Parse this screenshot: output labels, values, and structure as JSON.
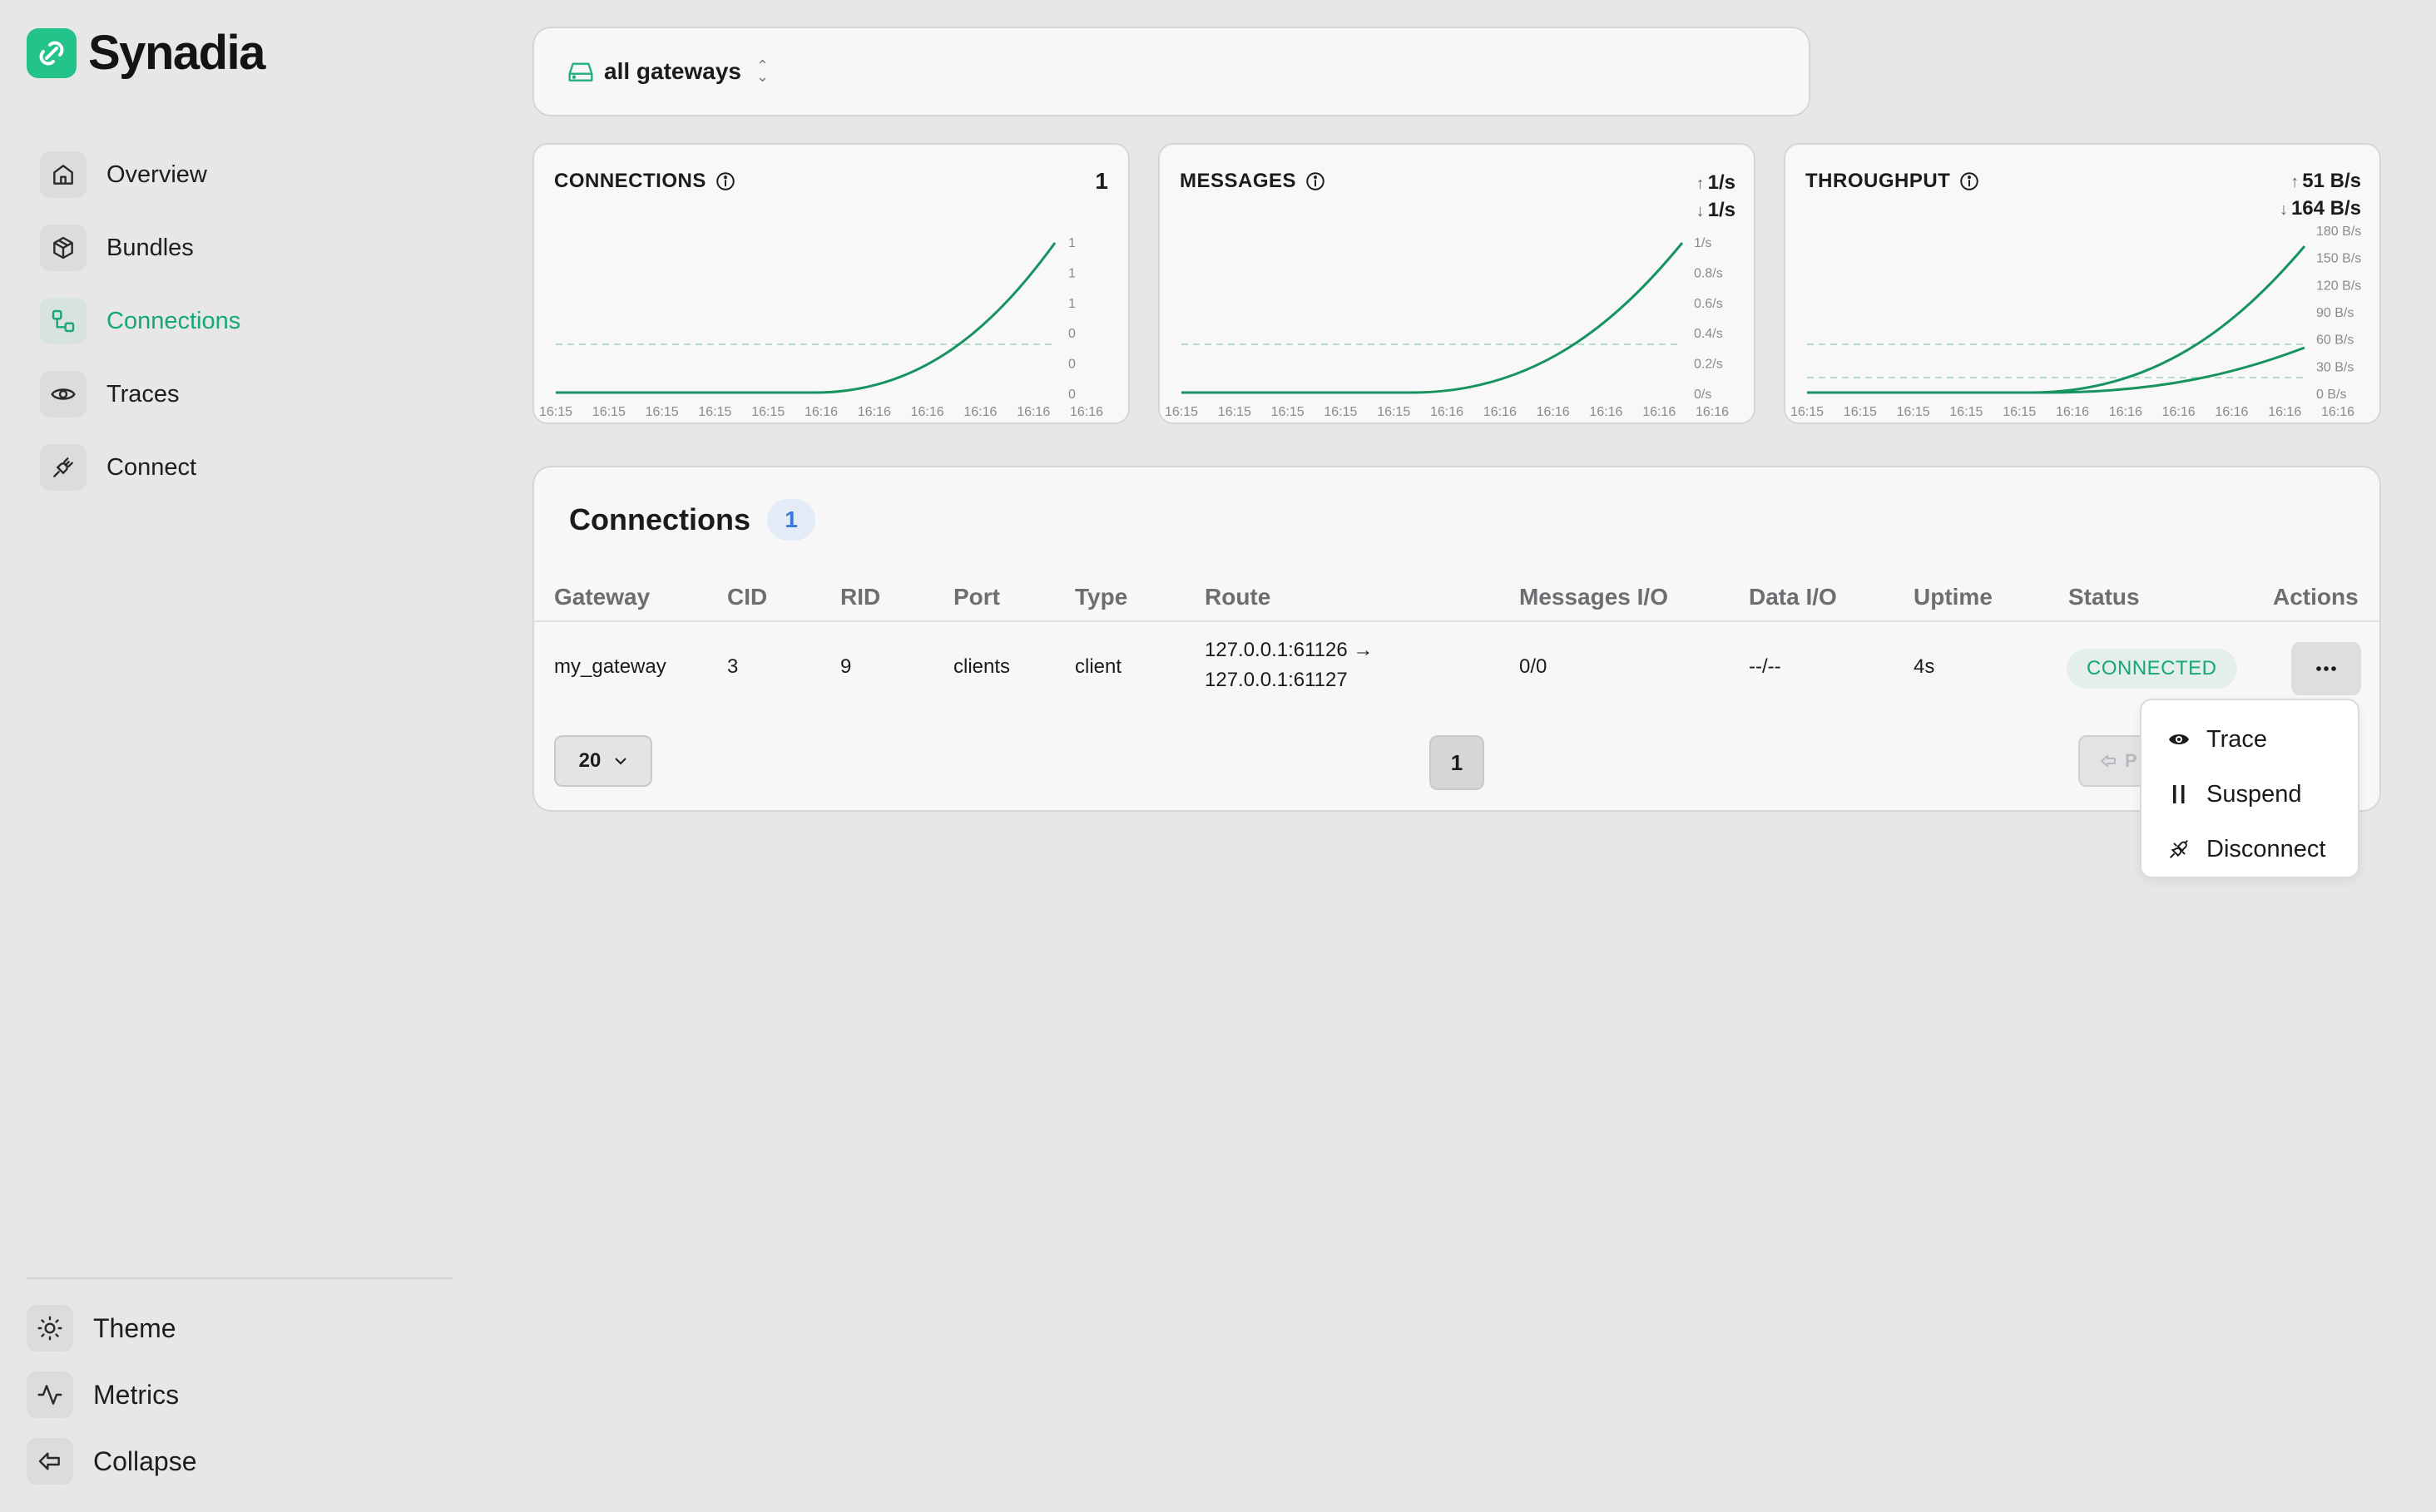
{
  "brand": {
    "name": "Synadia",
    "color": "#23c38a"
  },
  "sidebar": {
    "items": [
      {
        "label": "Overview",
        "icon": "home-icon",
        "active": false
      },
      {
        "label": "Bundles",
        "icon": "box-icon",
        "active": false
      },
      {
        "label": "Connections",
        "icon": "connections-icon",
        "active": true
      },
      {
        "label": "Traces",
        "icon": "eye-icon",
        "active": false
      },
      {
        "label": "Connect",
        "icon": "plug-icon",
        "active": false
      }
    ],
    "bottom": [
      {
        "label": "Theme",
        "icon": "sun-icon"
      },
      {
        "label": "Metrics",
        "icon": "activity-icon"
      },
      {
        "label": "Collapse",
        "icon": "collapse-arrow-icon"
      }
    ]
  },
  "gateway_selector": {
    "value": "all gateways"
  },
  "metrics": {
    "connections": {
      "title": "CONNECTIONS",
      "value": "1",
      "y_ticks": [
        "1",
        "1",
        "1",
        "0",
        "0",
        "0"
      ],
      "x_ticks": [
        "16:15",
        "16:15",
        "16:15",
        "16:15",
        "16:15",
        "16:16",
        "16:16",
        "16:16",
        "16:16",
        "16:16",
        "16:16"
      ]
    },
    "messages": {
      "title": "MESSAGES",
      "up": "1/s",
      "down": "1/s",
      "y_ticks": [
        "1/s",
        "0.8/s",
        "0.6/s",
        "0.4/s",
        "0.2/s",
        "0/s"
      ],
      "x_ticks": [
        "16:15",
        "16:15",
        "16:15",
        "16:15",
        "16:15",
        "16:16",
        "16:16",
        "16:16",
        "16:16",
        "16:16",
        "16:16"
      ]
    },
    "throughput": {
      "title": "THROUGHPUT",
      "up": "51 B/s",
      "down": "164 B/s",
      "y_ticks": [
        "180 B/s",
        "150 B/s",
        "120 B/s",
        "90 B/s",
        "60 B/s",
        "30 B/s",
        "0 B/s"
      ],
      "x_ticks": [
        "16:15",
        "16:15",
        "16:15",
        "16:15",
        "16:15",
        "16:16",
        "16:16",
        "16:16",
        "16:16",
        "16:16",
        "16:16"
      ]
    },
    "line_color": "#16935f"
  },
  "connections_table": {
    "title": "Connections",
    "count": "1",
    "columns": [
      "Gateway",
      "CID",
      "RID",
      "Port",
      "Type",
      "Route",
      "Messages I/O",
      "Data I/O",
      "Uptime",
      "Status",
      "Actions"
    ],
    "rows": [
      {
        "gateway": "my_gateway",
        "cid": "3",
        "rid": "9",
        "port": "clients",
        "type": "client",
        "route_from": "127.0.0.1:61126 →",
        "route_to": "127.0.0.1:61127",
        "messages_io": "0/0",
        "data_io": "--/--",
        "uptime": "4s",
        "status": "CONNECTED"
      }
    ],
    "page_size": "20",
    "current_page": "1",
    "prev_label": "P"
  },
  "actions_menu": {
    "items": [
      {
        "label": "Trace",
        "icon": "eye-icon"
      },
      {
        "label": "Suspend",
        "icon": "pause-icon"
      },
      {
        "label": "Disconnect",
        "icon": "unplug-icon"
      }
    ]
  }
}
